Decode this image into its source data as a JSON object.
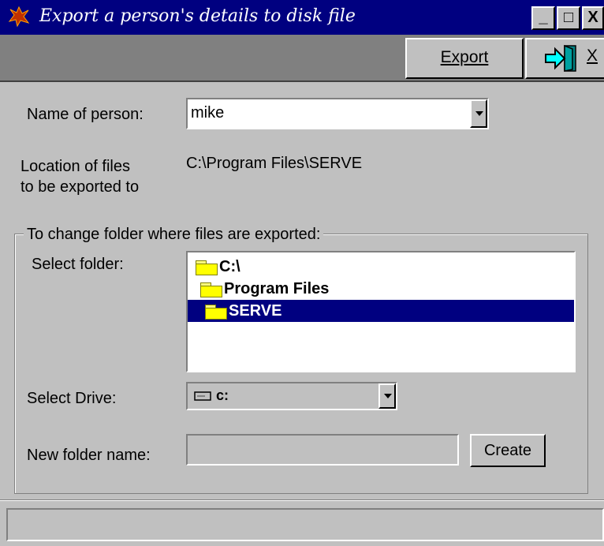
{
  "window": {
    "title": "Export a person's details to disk file",
    "minimize_glyph": "_",
    "maximize_glyph": "□",
    "close_glyph": "X"
  },
  "toolbar": {
    "export_label": "Export",
    "exit_label": "X"
  },
  "form": {
    "name_label": "Name of person:",
    "name_value": "mike",
    "location_label_line1": "Location of files",
    "location_label_line2": "to be exported to",
    "location_value": "C:\\Program Files\\SERVE"
  },
  "folder_group": {
    "title": "To change folder where files are exported:",
    "select_folder_label": "Select folder:",
    "folders": [
      {
        "label": "C:\\",
        "selected": false
      },
      {
        "label": "Program Files",
        "selected": false
      },
      {
        "label": "SERVE",
        "selected": true
      }
    ],
    "select_drive_label": "Select Drive:",
    "drive_value": "c:",
    "new_folder_label": "New folder name:",
    "new_folder_value": "",
    "create_label": "Create"
  },
  "status_bar": {
    "text": ""
  },
  "icons": {
    "app": "app-icon",
    "exit": "exit-door-icon",
    "drive": "drive-icon",
    "folder": "open-folder-icon"
  },
  "colors": {
    "titlebar": "#000080",
    "selection": "#000080",
    "face": "#c0c0c0",
    "toolbar": "#808080"
  }
}
